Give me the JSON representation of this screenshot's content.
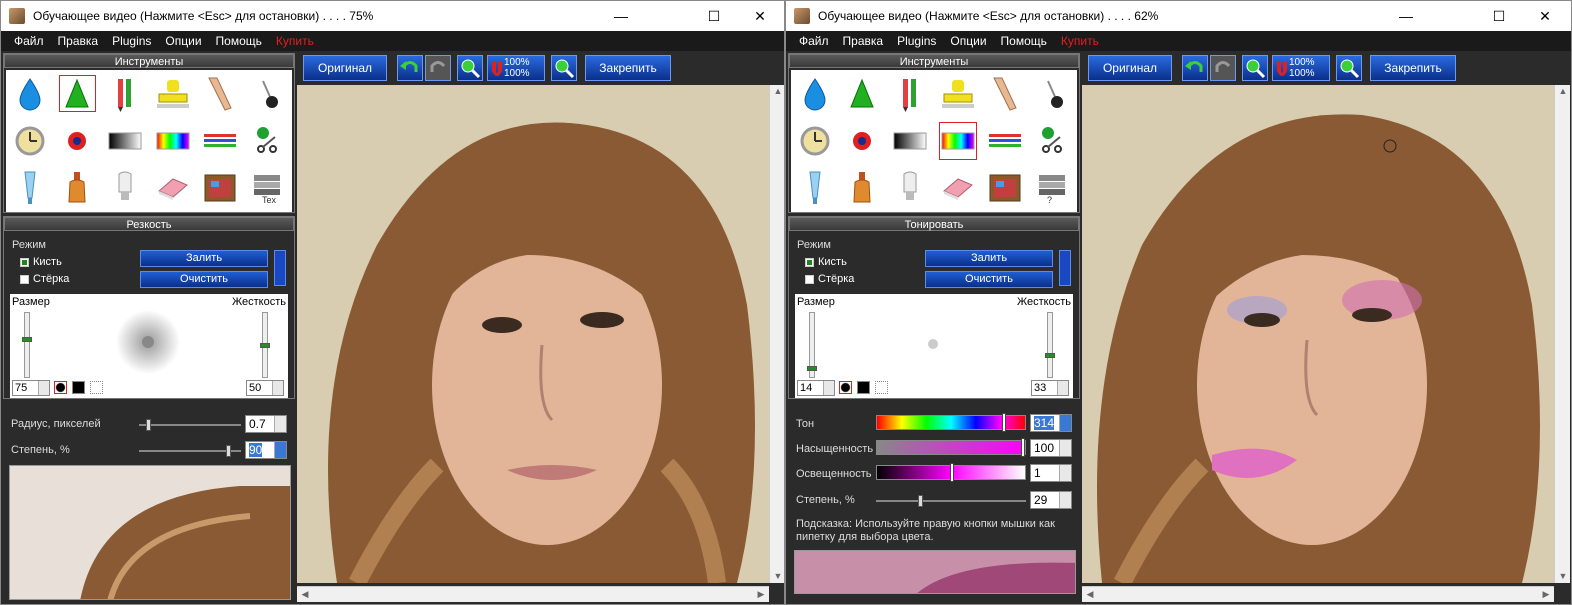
{
  "windows": [
    {
      "title": "Обучающее видео (Нажмите <Esc> для остановки) . . . . 75%",
      "menu": [
        "Файл",
        "Правка",
        "Plugins",
        "Опции",
        "Помощь",
        "Купить"
      ],
      "tools_header": "Инструменты",
      "section_header": "Резкость",
      "mode_label": "Режим",
      "brush_label": "Кисть",
      "eraser_label": "Стёрка",
      "fill_button": "Залить",
      "clear_button": "Очистить",
      "size_label": "Размер",
      "hardness_label": "Жесткость",
      "size_value": "75",
      "hardness_value": "50",
      "radius_label": "Радиус, пикселей",
      "radius_value": "0.7",
      "degree_label": "Степень, %",
      "degree_value": "90",
      "original_button": "Оригинал",
      "lock_button": "Закрепить",
      "zoom_label_top": "100%",
      "zoom_label_bottom": "100%",
      "size_fraction": 0.6,
      "hardness_fraction": 0.5,
      "radius_fraction": 0.07,
      "degree_fraction": 0.9
    },
    {
      "title": "Обучающее видео (Нажмите <Esc> для остановки) . . . . 62%",
      "menu": [
        "Файл",
        "Правка",
        "Plugins",
        "Опции",
        "Помощь",
        "Купить"
      ],
      "tools_header": "Инструменты",
      "section_header": "Тонировать",
      "mode_label": "Режим",
      "brush_label": "Кисть",
      "eraser_label": "Стёрка",
      "fill_button": "Залить",
      "clear_button": "Очистить",
      "size_label": "Размер",
      "hardness_label": "Жесткость",
      "size_value": "14",
      "hardness_value": "33",
      "hue_label": "Тон",
      "hue_value": "314",
      "saturation_label": "Насыщенность",
      "saturation_value": "100",
      "lightness_label": "Освещенность",
      "lightness_value": "1",
      "degree_label": "Степень, %",
      "degree_value": "29",
      "hint": "Подсказка: Используйте правую кнопки мышки как пипетку для выбора цвета.",
      "original_button": "Оригинал",
      "lock_button": "Закрепить",
      "zoom_label_top": "100%",
      "zoom_label_bottom": "100%",
      "size_fraction": 0.1,
      "hardness_fraction": 0.33,
      "hue_fraction": 0.87,
      "saturation_fraction": 1.0,
      "lightness_fraction": 0.51,
      "degree_fraction": 0.29
    }
  ],
  "colors": {
    "accent_blue": "#1f5fd6",
    "buy_red": "#e02020",
    "panel_dark": "#2b2b2b"
  }
}
